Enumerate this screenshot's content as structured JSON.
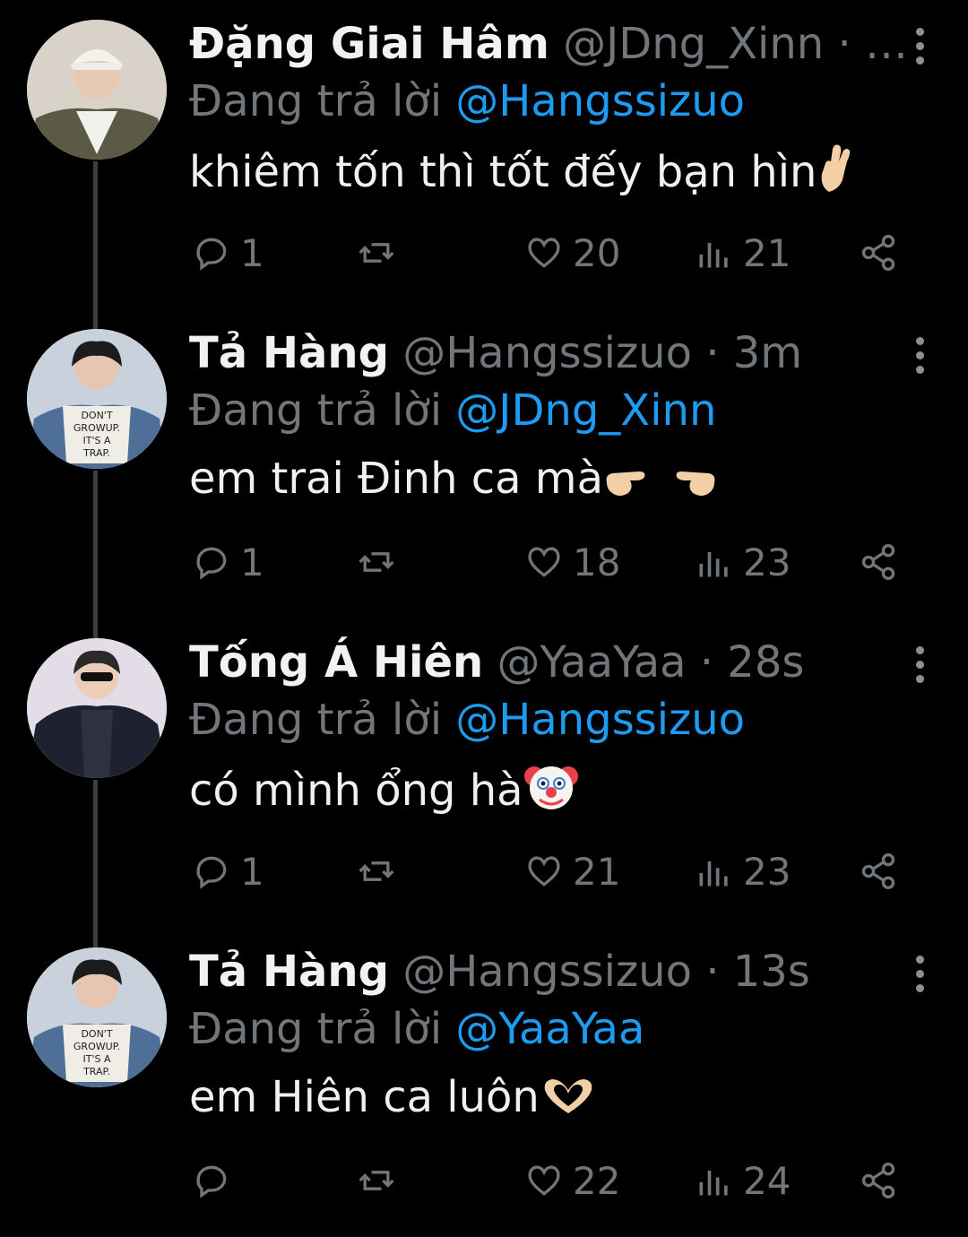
{
  "tweets": [
    {
      "name": "Đặng Giai Hâm",
      "handle": "@JDng_Xinn",
      "time": "· …",
      "reply_prefix": "Đang trả lời",
      "reply_to": "@Hangssizuo",
      "text": "khiêm tốn thì tốt đếy bạn hìn",
      "emoji": "crossed-fingers",
      "replies": "1",
      "retweets": "",
      "likes": "20",
      "views": "21",
      "avatar": "avatar-jacket"
    },
    {
      "name": "Tả Hàng",
      "handle": "@Hangssizuo",
      "time": "· 3m",
      "reply_prefix": "Đang trả lời",
      "reply_to": "@JDng_Xinn",
      "text": "em trai Đinh ca mà",
      "emoji": "pointing-hands",
      "replies": "1",
      "retweets": "",
      "likes": "18",
      "views": "23",
      "avatar": "avatar-dont-grow-up"
    },
    {
      "name": "Tống Á Hiên",
      "handle": "@YaaYaa",
      "time": "· 28s",
      "reply_prefix": "Đang trả lời",
      "reply_to": "@Hangssizuo",
      "text": "có mình ổng hà",
      "emoji": "clown-face",
      "replies": "1",
      "retweets": "",
      "likes": "21",
      "views": "23",
      "avatar": "avatar-puffer"
    },
    {
      "name": "Tả Hàng",
      "handle": "@Hangssizuo",
      "time": "· 13s",
      "reply_prefix": "Đang trả lời",
      "reply_to": "@YaaYaa",
      "text": "em Hiên ca luôn",
      "emoji": "heart-hands",
      "replies": "",
      "retweets": "",
      "likes": "22",
      "views": "24",
      "avatar": "avatar-dont-grow-up"
    }
  ],
  "avatar_texts": {
    "dont_grow_up": [
      "DON'T",
      "GROWUP.",
      "IT'S A",
      "TRAP."
    ]
  },
  "colors": {
    "background": "#000000",
    "mention": "#1d9bf0",
    "muted": "#71767b"
  }
}
